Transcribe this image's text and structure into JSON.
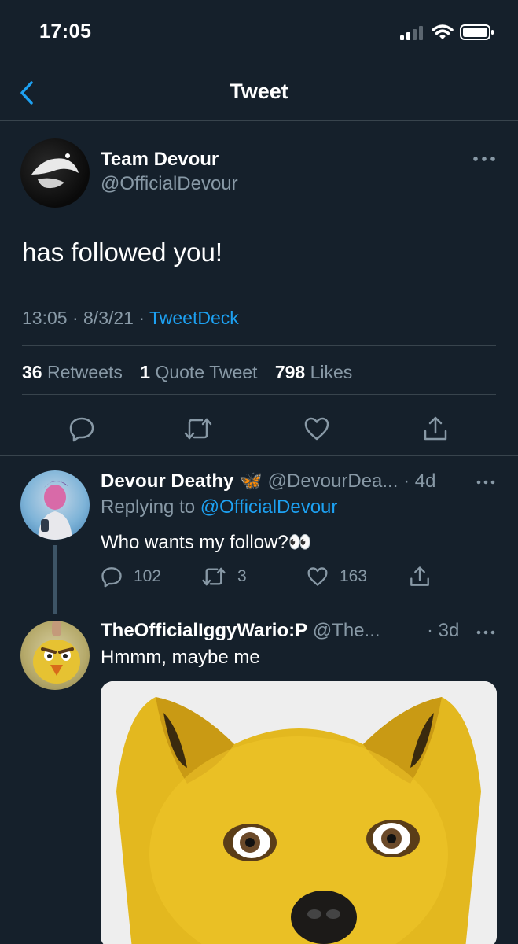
{
  "status_bar": {
    "time": "17:05"
  },
  "nav": {
    "title": "Tweet"
  },
  "main_tweet": {
    "author_name": "Team Devour",
    "author_handle": "@OfficialDevour",
    "text": "has followed you!",
    "time": "13:05",
    "date": "8/3/21",
    "source": "TweetDeck",
    "stats": {
      "retweets_count": "36",
      "retweets_label": "Retweets",
      "quotes_count": "1",
      "quotes_label": "Quote Tweet",
      "likes_count": "798",
      "likes_label": "Likes"
    }
  },
  "replies": [
    {
      "name": "Devour Deathy",
      "name_emoji": "🦋",
      "handle": "@DevourDea...",
      "age": "· 4d",
      "replying_prefix": "Replying to",
      "replying_to": "@OfficialDevour",
      "text": "Who wants my follow?👀",
      "reply_count": "102",
      "retweet_count": "3",
      "like_count": "163"
    },
    {
      "name": "TheOfficialIggyWario:P",
      "handle": "@The...",
      "age": "· 3d",
      "text": "Hmmm, maybe me"
    }
  ],
  "colors": {
    "background": "#15202b",
    "accent": "#1da1f2",
    "secondary_text": "#8899a6",
    "divider": "#38444d"
  }
}
